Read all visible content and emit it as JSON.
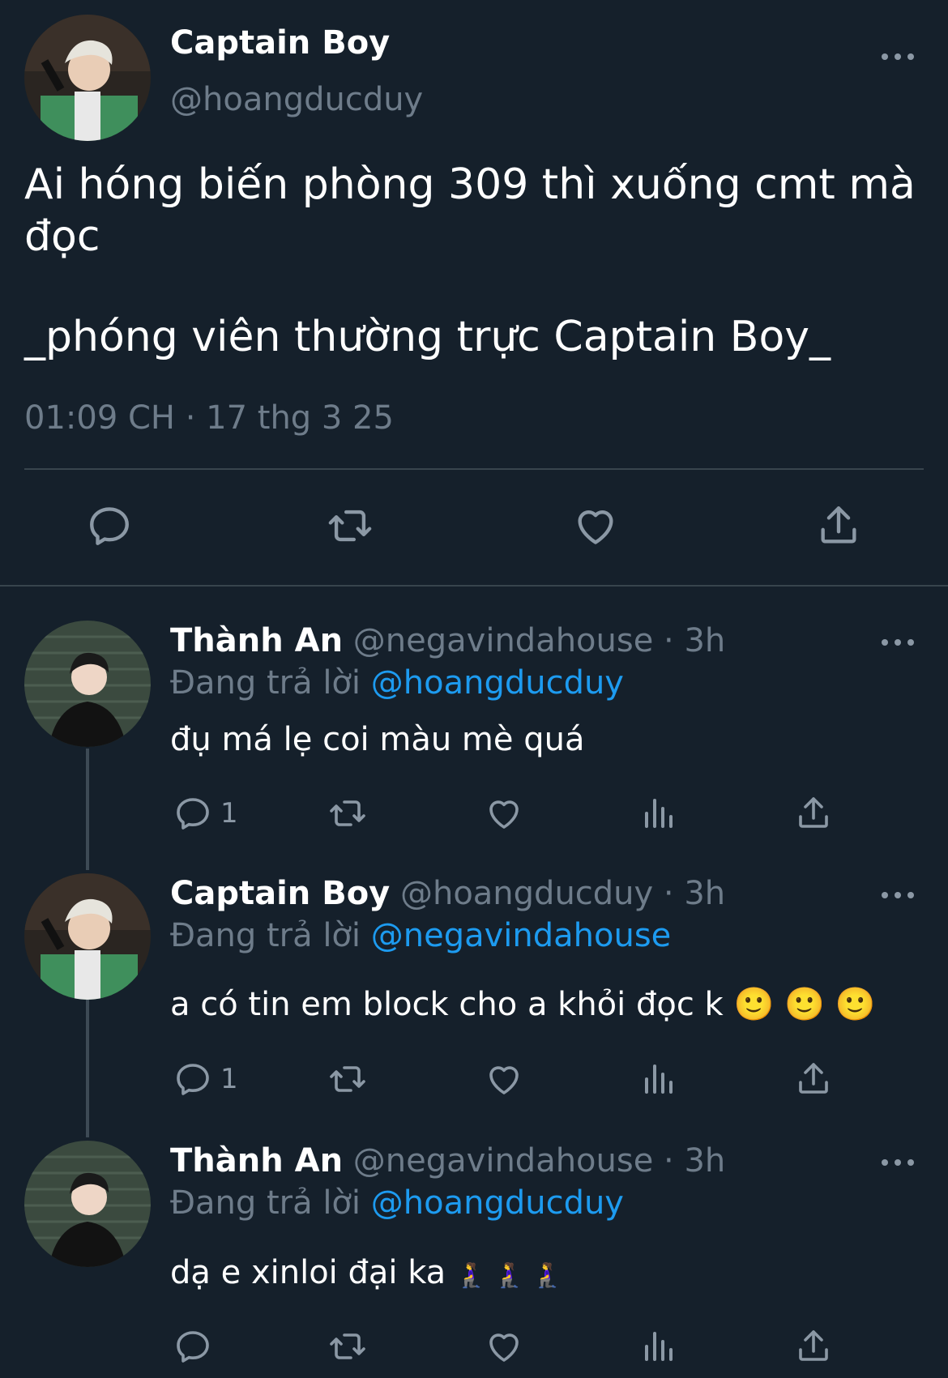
{
  "main_tweet": {
    "author_name": "Captain Boy",
    "author_handle": "@hoangducduy",
    "text_line1": "Ai hóng biến phòng 309 thì xuống cmt mà đọc",
    "text_line2": "_phóng viên thường trực Captain Boy_",
    "timestamp": "01:09 CH · 17 thg 3 25",
    "actions": [
      "reply-icon",
      "retweet-icon",
      "like-icon",
      "share-icon"
    ]
  },
  "replies": [
    {
      "author_name": "Thành An",
      "author_handle": "@negavindahouse",
      "time": "· 3h",
      "replying_label": "Đang trả lời",
      "replying_to": "@hoangducduy",
      "text": "đụ má lẹ coi màu mè quá",
      "reply_count": "1"
    },
    {
      "author_name": "Captain Boy",
      "author_handle": "@hoangducduy",
      "time": "· 3h",
      "replying_label": "Đang trả lời",
      "replying_to": "@negavindahouse",
      "text": "a có tin em block cho a khỏi đọc k",
      "emojis": "🙂 🙂 🙂",
      "reply_count": "1"
    },
    {
      "author_name": "Thành An",
      "author_handle": "@negavindahouse",
      "time": "· 3h",
      "replying_label": "Đang trả lời",
      "replying_to": "@hoangducduy",
      "text": "dạ e xinloi đại ka",
      "emojis": "🧎‍♀️ 🧎‍♀️ 🧎‍♀️",
      "reply_count": ""
    }
  ],
  "colors": {
    "background": "#15202b",
    "secondary_text": "#6e7c8a",
    "mention": "#1d9bf0",
    "divider": "#38444d"
  }
}
